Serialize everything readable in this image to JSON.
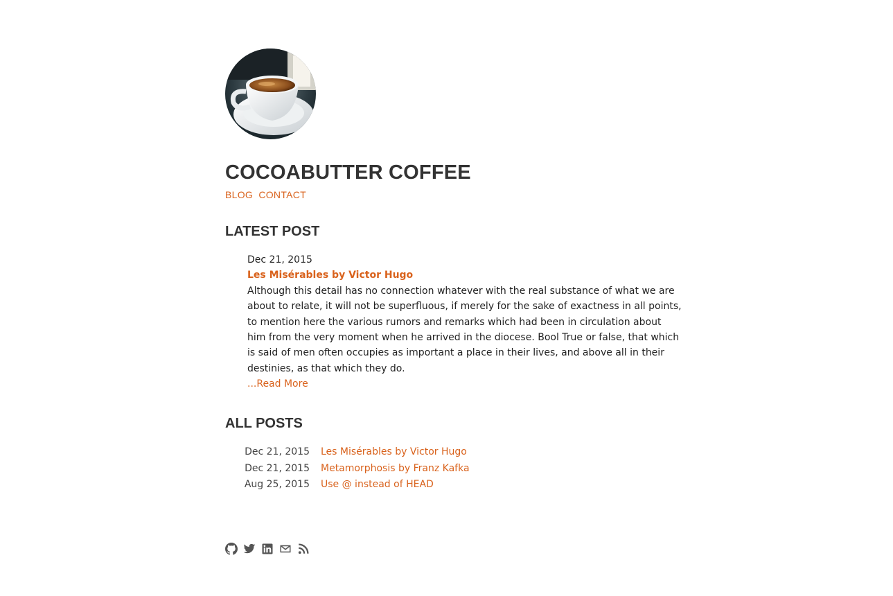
{
  "site": {
    "title": "COCOABUTTER COFFEE",
    "avatar_icon": "coffee-cup-photo"
  },
  "nav": {
    "items": [
      {
        "label": "BLOG"
      },
      {
        "label": "CONTACT"
      }
    ]
  },
  "latest": {
    "heading": "LATEST POST",
    "date": "Dec 21, 2015",
    "title": "Les Misérables by Victor Hugo",
    "excerpt": "Although this detail has no connection whatever with the real substance of what we are about to relate, it will not be superfluous, if merely for the sake of exactness in all points, to mention here the various rumors and remarks which had been in circulation about him from the very moment when he arrived in the diocese. Bool True or false, that which is said of men often occupies as important a place in their lives, and above all in their destinies, as that which they do.",
    "read_more": "...Read More"
  },
  "all_posts": {
    "heading": "ALL POSTS",
    "items": [
      {
        "date": "Dec 21, 2015",
        "title": "Les Misérables by Victor Hugo"
      },
      {
        "date": "Dec 21, 2015",
        "title": "Metamorphosis by Franz Kafka"
      },
      {
        "date": "Aug 25, 2015",
        "title": "Use @ instead of HEAD"
      }
    ]
  },
  "social": {
    "icons": [
      "github-icon",
      "twitter-icon",
      "linkedin-icon",
      "email-icon",
      "rss-icon"
    ],
    "color": "#555555"
  },
  "colors": {
    "accent": "#d9621c",
    "heading": "#333333",
    "text": "#222222"
  }
}
